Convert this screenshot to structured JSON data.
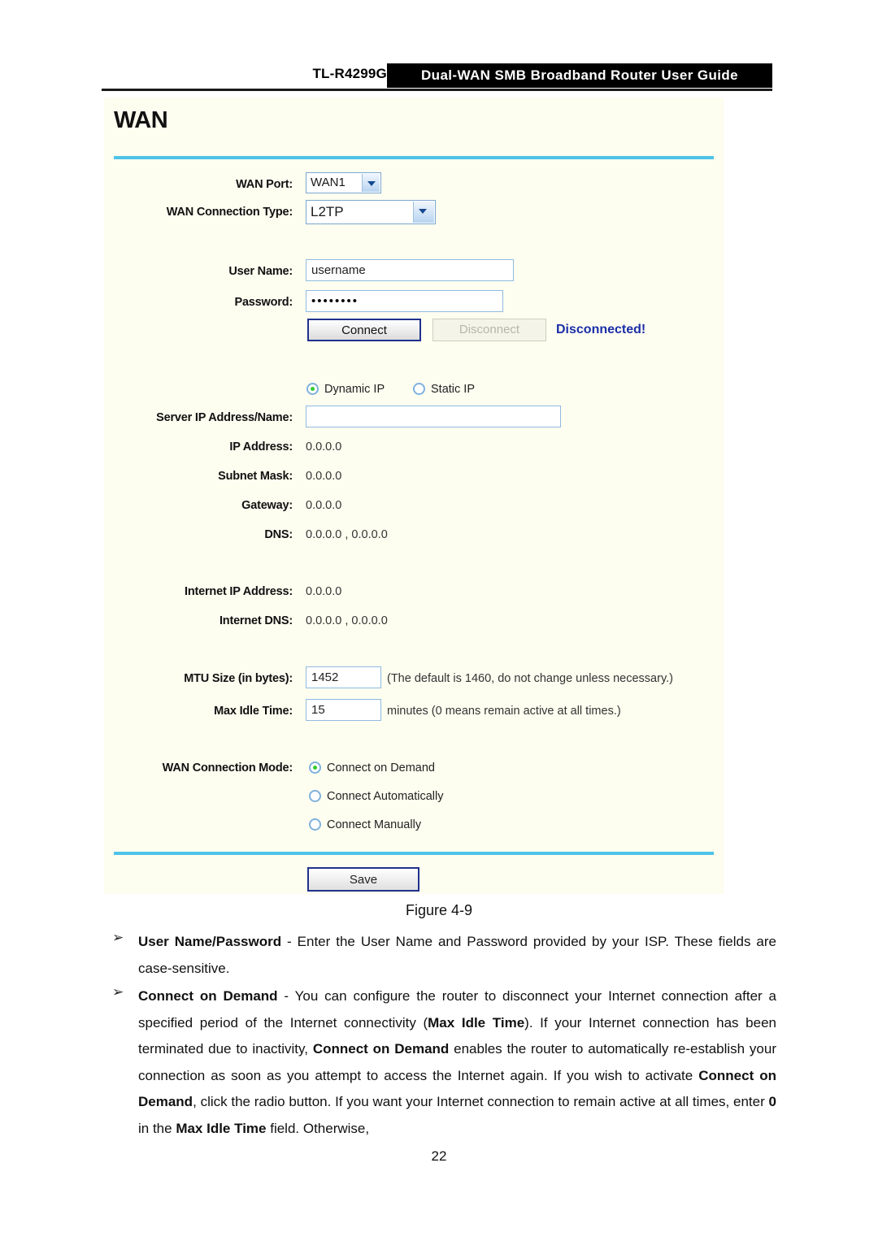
{
  "header": {
    "model": "TL-R4299G",
    "title": "Dual-WAN SMB Broadband Router User Guide"
  },
  "panel": {
    "title": "WAN",
    "accent_color": "#4ec3e8",
    "background_color": "#fdfdf0"
  },
  "form": {
    "wan_port": {
      "label": "WAN Port:",
      "value": "WAN1"
    },
    "wan_connection_type": {
      "label": "WAN Connection Type:",
      "value": "L2TP"
    },
    "user_name": {
      "label": "User Name:",
      "value": "username"
    },
    "password": {
      "label": "Password:",
      "value": "••••••••"
    },
    "connect_button": "Connect",
    "disconnect_button": "Disconnect",
    "status_text": "Disconnected!",
    "status_color": "#1a2ea8",
    "ip_mode": {
      "dynamic_label": "Dynamic IP",
      "static_label": "Static IP",
      "selected": "Dynamic IP"
    },
    "server_ip_address_name": {
      "label": "Server IP Address/Name:",
      "value": ""
    },
    "ip_address": {
      "label": "IP Address:",
      "value": "0.0.0.0"
    },
    "subnet_mask": {
      "label": "Subnet Mask:",
      "value": "0.0.0.0"
    },
    "gateway": {
      "label": "Gateway:",
      "value": "0.0.0.0"
    },
    "dns": {
      "label": "DNS:",
      "value": "0.0.0.0 , 0.0.0.0"
    },
    "internet_ip_address": {
      "label": "Internet IP Address:",
      "value": "0.0.0.0"
    },
    "internet_dns": {
      "label": "Internet DNS:",
      "value": "0.0.0.0 , 0.0.0.0"
    },
    "mtu_size": {
      "label": "MTU Size (in bytes):",
      "value": "1452",
      "hint": "(The default is 1460, do not change unless necessary.)"
    },
    "max_idle_time": {
      "label": "Max Idle Time:",
      "value": "15",
      "hint": "minutes (0 means remain active at all times.)"
    },
    "wan_connection_mode": {
      "label": "WAN Connection Mode:",
      "options": [
        "Connect on Demand",
        "Connect Automatically",
        "Connect Manually"
      ],
      "selected": "Connect on Demand"
    },
    "save_button": "Save"
  },
  "figure_caption": "Figure 4-9",
  "body": {
    "bullet_marker": "➢",
    "items": [
      {
        "term": "User Name/Password",
        "text": " - Enter the User Name and Password provided by your ISP. These fields are case-sensitive."
      },
      {
        "term": "Connect on Demand",
        "text": " - You can configure the router to disconnect your Internet connection after a specified period of the Internet connectivity ("
      }
    ],
    "para2_b1": "Max Idle Time",
    "para2_t1": "). If your Internet connection has been terminated due to inactivity, ",
    "para2_b2": "Connect on Demand",
    "para2_t2": " enables the router to automatically re-establish your connection as soon as you attempt to access the Internet again. If you wish to activate ",
    "para2_b3": "Connect on Demand",
    "para2_t3": ", click the radio button. If you want your Internet connection to remain active at all times, enter ",
    "para2_b4": "0",
    "para2_t4": " in the ",
    "para2_b5": "Max Idle Time",
    "para2_t5": " field. Otherwise,"
  },
  "page_number": "22"
}
